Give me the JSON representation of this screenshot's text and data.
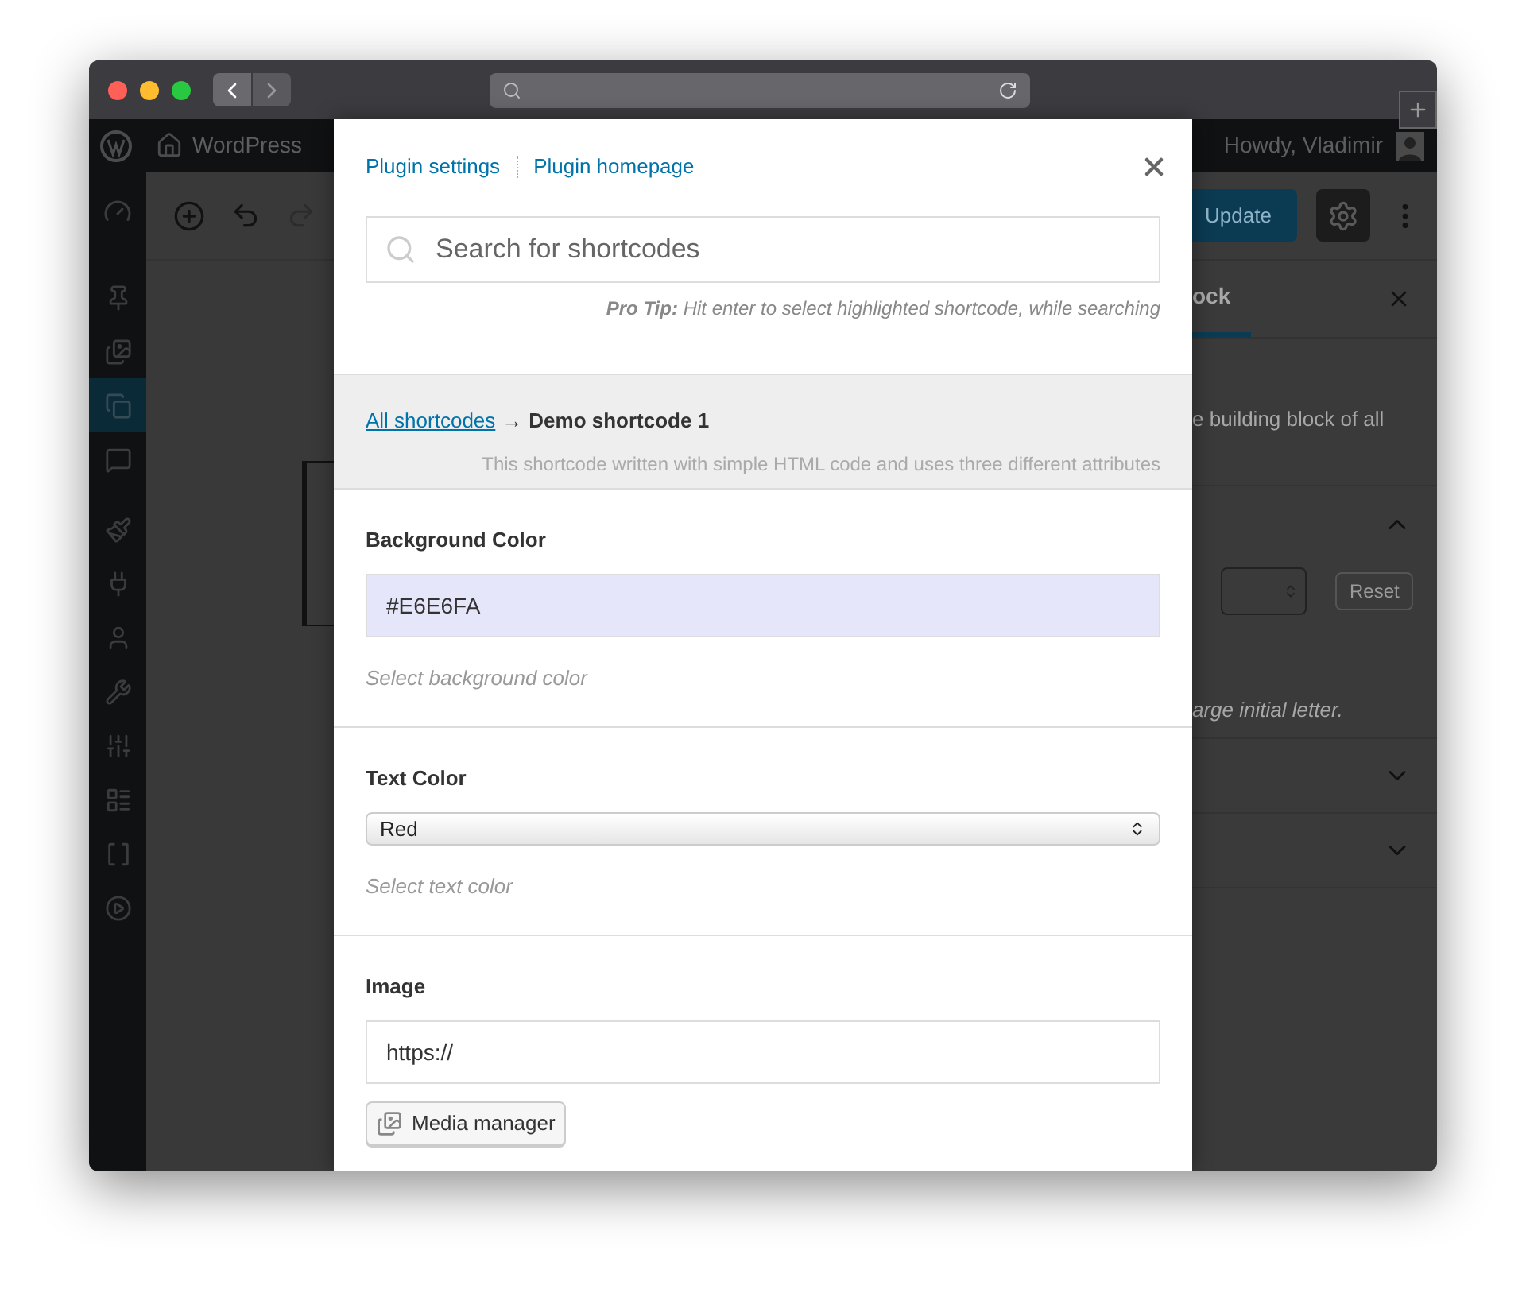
{
  "admin_bar": {
    "site_name": "WordPress",
    "greeting": "Howdy, Vladimir"
  },
  "sidebar": {
    "items": [
      {
        "selected": false
      },
      {
        "selected": false
      },
      {
        "selected": true
      },
      {
        "selected": false
      },
      {
        "selected": false
      },
      {
        "selected": false
      },
      {
        "selected": false
      },
      {
        "selected": false
      },
      {
        "selected": false
      },
      {
        "selected": false
      },
      {
        "selected": false
      },
      {
        "selected": false
      }
    ]
  },
  "editor": {
    "update_button": "Update"
  },
  "settings_panel": {
    "tab": "ock",
    "description": "e building block of all",
    "reset_button": "Reset",
    "hint": "arge initial letter.",
    "sections": [
      {
        "expanded": true
      },
      {
        "expanded": false
      },
      {
        "expanded": false
      }
    ]
  },
  "modal": {
    "links": [
      "Plugin settings",
      "Plugin homepage"
    ],
    "search": {
      "placeholder": "Search for shortcodes"
    },
    "pro_tip": "**Pro Tip:** Hit enter to select highlighted shortcode, while searching",
    "breadcrumb": {
      "link": "All shortcodes",
      "arrow": "→",
      "current": "Demo shortcode 1",
      "description": "This shortcode written with simple HTML code and uses three different attributes"
    },
    "fields": [
      {
        "kind": "color",
        "label": "Background Color",
        "value": "#E6E6FA",
        "hint": "Select background color"
      },
      {
        "kind": "select",
        "label": "Text Color",
        "value": "Red",
        "hint": "Select text color"
      },
      {
        "kind": "url",
        "label": "Image",
        "value": "https://",
        "button": "Media manager"
      }
    ]
  }
}
